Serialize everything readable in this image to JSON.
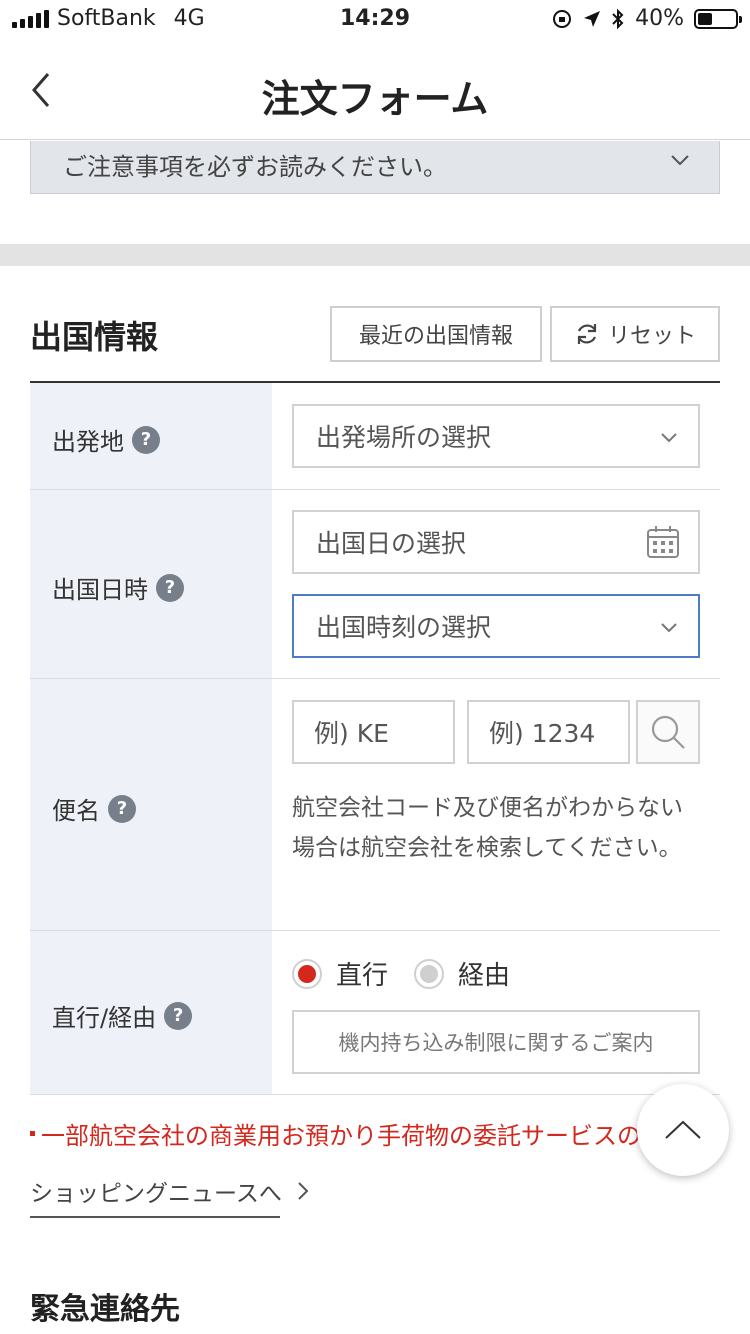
{
  "status_bar": {
    "carrier": "SoftBank",
    "network": "4G",
    "time": "14:29",
    "battery": "40%",
    "battery_level": 0.4
  },
  "nav": {
    "title": "注文フォーム"
  },
  "notice": {
    "text": "ご注意事項を必ずお読みください。"
  },
  "section": {
    "title": "出国情報",
    "recent_button": "最近の出国情報",
    "reset_button": "リセット"
  },
  "rows": {
    "departure_place": {
      "label": "出発地",
      "select_placeholder": "出発場所の選択"
    },
    "departure_datetime": {
      "label": "出国日時",
      "date_placeholder": "出国日の選択",
      "time_placeholder": "出国時刻の選択"
    },
    "flight": {
      "label": "便名",
      "airline_placeholder": "例) KE",
      "number_placeholder": "例) 1234",
      "help": "航空会社コード及び便名がわからない場合は航空会社を検索してください。"
    },
    "route": {
      "label": "直行/経由",
      "option_direct": "直行",
      "option_via": "経由",
      "selected": "直行",
      "carry_on_button": "機内持ち込み制限に関するご案内"
    }
  },
  "alert_text": "一部航空会社の商業用お預かり手荷物の委託サービスの中止",
  "shopping_link": "ショッピングニュースへ",
  "emergency_title": "緊急連絡先",
  "colors": {
    "accent_red": "#d4281e",
    "focus_blue": "#4d7cc4",
    "label_bg": "#eef2f8"
  }
}
